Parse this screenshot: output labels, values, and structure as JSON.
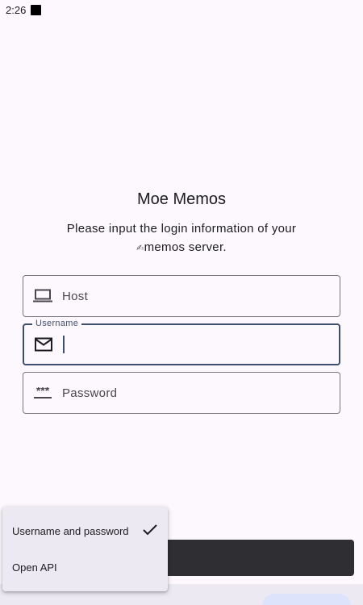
{
  "status_bar": {
    "time": "2:26"
  },
  "header": {
    "title": "Moe Memos",
    "subtitle_line1": "Please input the login information of your",
    "subtitle_line2": "memos server."
  },
  "form": {
    "host": {
      "placeholder": "Host",
      "icon": "laptop-icon"
    },
    "username": {
      "label": "Username",
      "value": "",
      "icon": "mail-icon"
    },
    "password": {
      "placeholder": "Password",
      "icon": "password-dots-icon"
    }
  },
  "login_method_menu": {
    "items": [
      {
        "label": "Username and password",
        "selected": true
      },
      {
        "label": "Open API",
        "selected": false
      }
    ]
  },
  "colors": {
    "background": "#fdf8fd",
    "focus": "#3e4f6e",
    "button": "#2f2f33",
    "menu": "#ece9f3"
  }
}
